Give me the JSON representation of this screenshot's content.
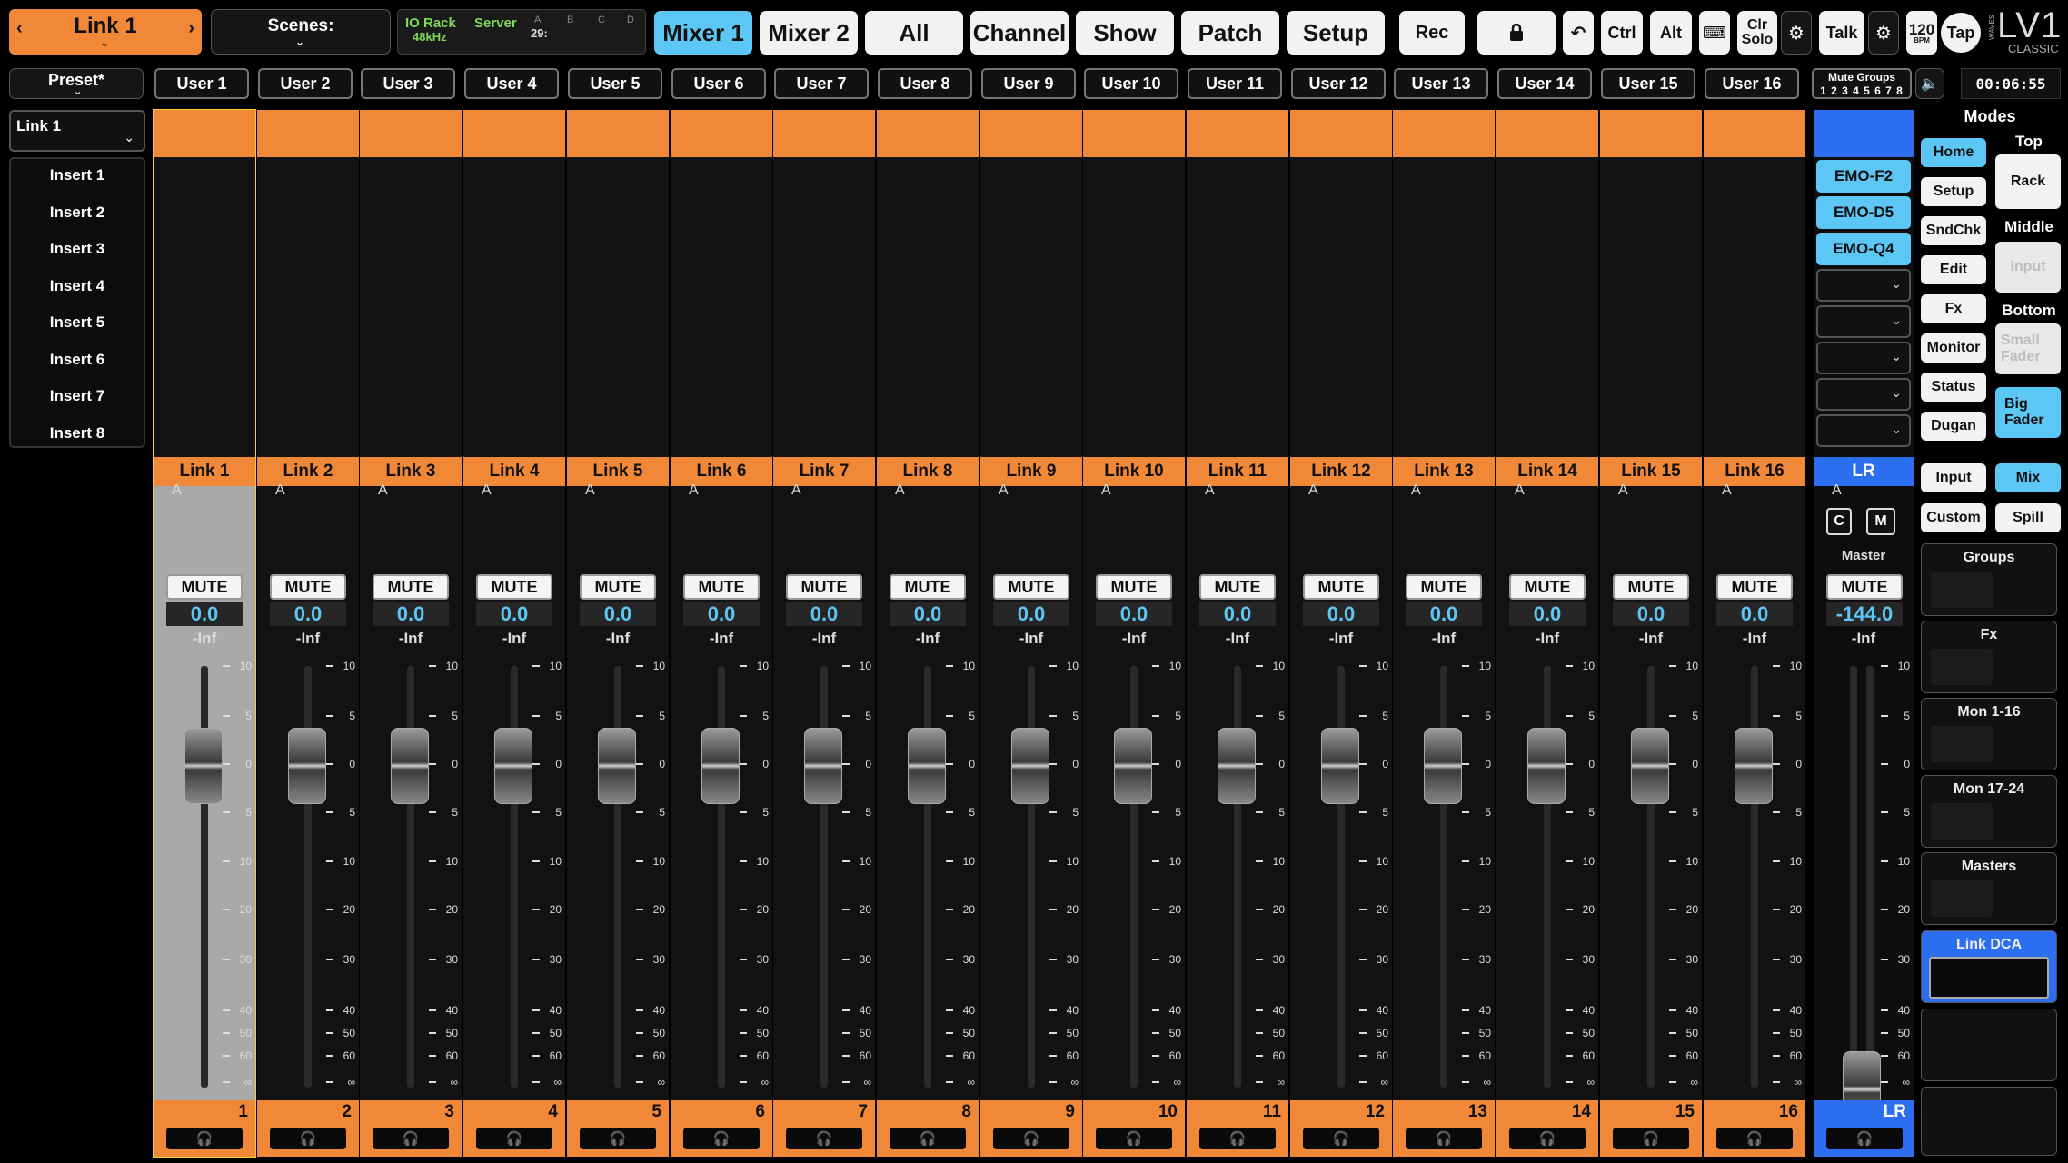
{
  "header": {
    "link_selector": "Link 1",
    "scenes_label": "Scenes:",
    "io_rack": "IO Rack",
    "sample_rate": "48kHz",
    "server": "Server",
    "server_num": "29:",
    "abcd": [
      "A",
      "B",
      "C",
      "D"
    ],
    "tabs": [
      "Mixer 1",
      "Mixer 2",
      "All",
      "Channel",
      "Show",
      "Patch",
      "Setup"
    ],
    "active_tab": "Mixer 1",
    "rec": "Rec",
    "ctrl": "Ctrl",
    "alt": "Alt",
    "clr_solo": "Clr Solo",
    "talk": "Talk",
    "bpm_value": "120",
    "bpm_unit": "BPM",
    "tap": "Tap",
    "logo": "LV1",
    "logo_sub": "CLASSIC",
    "brand_vertical": "WAVES"
  },
  "row2": {
    "preset": "Preset*",
    "users": [
      "User 1",
      "User 2",
      "User 3",
      "User 4",
      "User 5",
      "User 6",
      "User 7",
      "User 8",
      "User 9",
      "User 10",
      "User 11",
      "User 12",
      "User 13",
      "User 14",
      "User 15",
      "User 16"
    ],
    "mute_groups_label": "Mute Groups",
    "mute_groups_nums": "1 2 3 4 5 6 7 8",
    "clock": "00:06:55"
  },
  "inserts": {
    "header": "Link 1",
    "items": [
      "Insert 1",
      "Insert 2",
      "Insert 3",
      "Insert 4",
      "Insert 5",
      "Insert 6",
      "Insert 7",
      "Insert 8"
    ]
  },
  "channels": [
    {
      "name": "Link 1",
      "num": "1",
      "group": "A",
      "mute": "MUTE",
      "value": "0.0",
      "inf": "-Inf"
    },
    {
      "name": "Link 2",
      "num": "2",
      "group": "A",
      "mute": "MUTE",
      "value": "0.0",
      "inf": "-Inf"
    },
    {
      "name": "Link 3",
      "num": "3",
      "group": "A",
      "mute": "MUTE",
      "value": "0.0",
      "inf": "-Inf"
    },
    {
      "name": "Link 4",
      "num": "4",
      "group": "A",
      "mute": "MUTE",
      "value": "0.0",
      "inf": "-Inf"
    },
    {
      "name": "Link 5",
      "num": "5",
      "group": "A",
      "mute": "MUTE",
      "value": "0.0",
      "inf": "-Inf"
    },
    {
      "name": "Link 6",
      "num": "6",
      "group": "A",
      "mute": "MUTE",
      "value": "0.0",
      "inf": "-Inf"
    },
    {
      "name": "Link 7",
      "num": "7",
      "group": "A",
      "mute": "MUTE",
      "value": "0.0",
      "inf": "-Inf"
    },
    {
      "name": "Link 8",
      "num": "8",
      "group": "A",
      "mute": "MUTE",
      "value": "0.0",
      "inf": "-Inf"
    },
    {
      "name": "Link 9",
      "num": "9",
      "group": "A",
      "mute": "MUTE",
      "value": "0.0",
      "inf": "-Inf"
    },
    {
      "name": "Link 10",
      "num": "10",
      "group": "A",
      "mute": "MUTE",
      "value": "0.0",
      "inf": "-Inf"
    },
    {
      "name": "Link 11",
      "num": "11",
      "group": "A",
      "mute": "MUTE",
      "value": "0.0",
      "inf": "-Inf"
    },
    {
      "name": "Link 12",
      "num": "12",
      "group": "A",
      "mute": "MUTE",
      "value": "0.0",
      "inf": "-Inf"
    },
    {
      "name": "Link 13",
      "num": "13",
      "group": "A",
      "mute": "MUTE",
      "value": "0.0",
      "inf": "-Inf"
    },
    {
      "name": "Link 14",
      "num": "14",
      "group": "A",
      "mute": "MUTE",
      "value": "0.0",
      "inf": "-Inf"
    },
    {
      "name": "Link 15",
      "num": "15",
      "group": "A",
      "mute": "MUTE",
      "value": "0.0",
      "inf": "-Inf"
    },
    {
      "name": "Link 16",
      "num": "16",
      "group": "A",
      "mute": "MUTE",
      "value": "0.0",
      "inf": "-Inf"
    }
  ],
  "fader_scale": [
    "10",
    "5",
    "0",
    "5",
    "10",
    "20",
    "30",
    "40",
    "50",
    "60",
    "∞"
  ],
  "master": {
    "name": "LR",
    "group": "A",
    "c": "C",
    "m": "M",
    "label": "Master",
    "mute": "MUTE",
    "value": "-144.0",
    "inf": "-Inf",
    "num": "LR",
    "fader_level_db": "-144.0"
  },
  "emo": [
    "EMO-F2",
    "EMO-D5",
    "EMO-Q4"
  ],
  "modes": {
    "title": "Modes",
    "left": [
      "Home",
      "Setup",
      "SndChk",
      "Edit",
      "Fx",
      "Monitor",
      "Status",
      "Dugan"
    ],
    "top_label": "Top",
    "rack": "Rack",
    "middle_label": "Middle",
    "input_disabled": "Input",
    "bottom_label": "Bottom",
    "small_fader": "Small Fader",
    "big_fader": "Big Fader",
    "input": "Input",
    "mix": "Mix",
    "custom": "Custom",
    "spill": "Spill"
  },
  "layers": [
    "Groups",
    "Fx",
    "Mon 1-16",
    "Mon 17-24",
    "Masters",
    "Link DCA"
  ],
  "colors": {
    "orange": "#f08838",
    "blue": "#5cc7f5",
    "green": "#7ed957",
    "yellow_sel": "#f0d040"
  }
}
